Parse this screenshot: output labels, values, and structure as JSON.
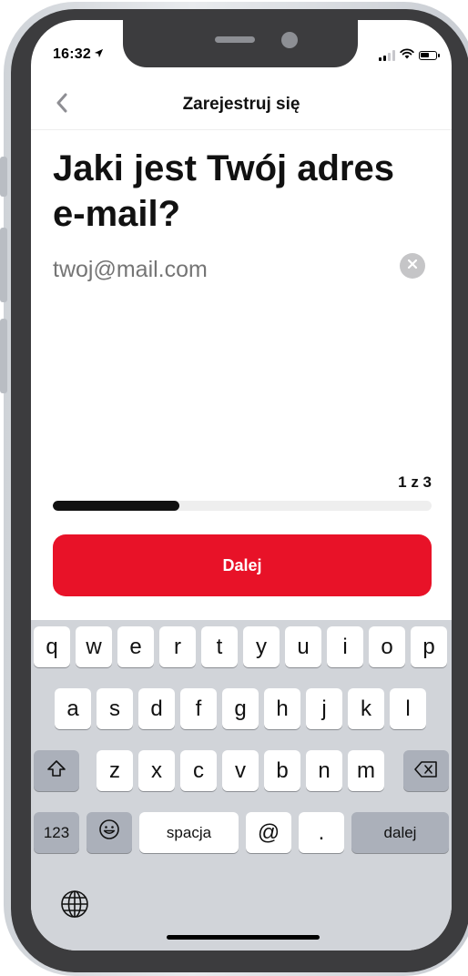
{
  "status_bar": {
    "time": "16:32",
    "location_arrow": "➤"
  },
  "nav": {
    "title": "Zarejestruj się",
    "back_icon": "chevron-left-icon"
  },
  "form": {
    "heading": "Jaki jest Twój adres e-mail?",
    "email_placeholder": "twoj@mail.com",
    "email_value": "",
    "clear_icon": "clear-x-icon"
  },
  "progress": {
    "label": "1 z 3",
    "current_step": 1,
    "total_steps": 3,
    "fraction": 0.333
  },
  "next_button": {
    "label": "Dalej",
    "color": "#e81228"
  },
  "keyboard": {
    "row1": [
      "q",
      "w",
      "e",
      "r",
      "t",
      "y",
      "u",
      "i",
      "o",
      "p"
    ],
    "row2": [
      "a",
      "s",
      "d",
      "f",
      "g",
      "h",
      "j",
      "k",
      "l"
    ],
    "row3": [
      "z",
      "x",
      "c",
      "v",
      "b",
      "n",
      "m"
    ],
    "numbers_key": "123",
    "space_key": "spacja",
    "at_key": "@",
    "dot_key": ".",
    "return_key": "dalej"
  }
}
